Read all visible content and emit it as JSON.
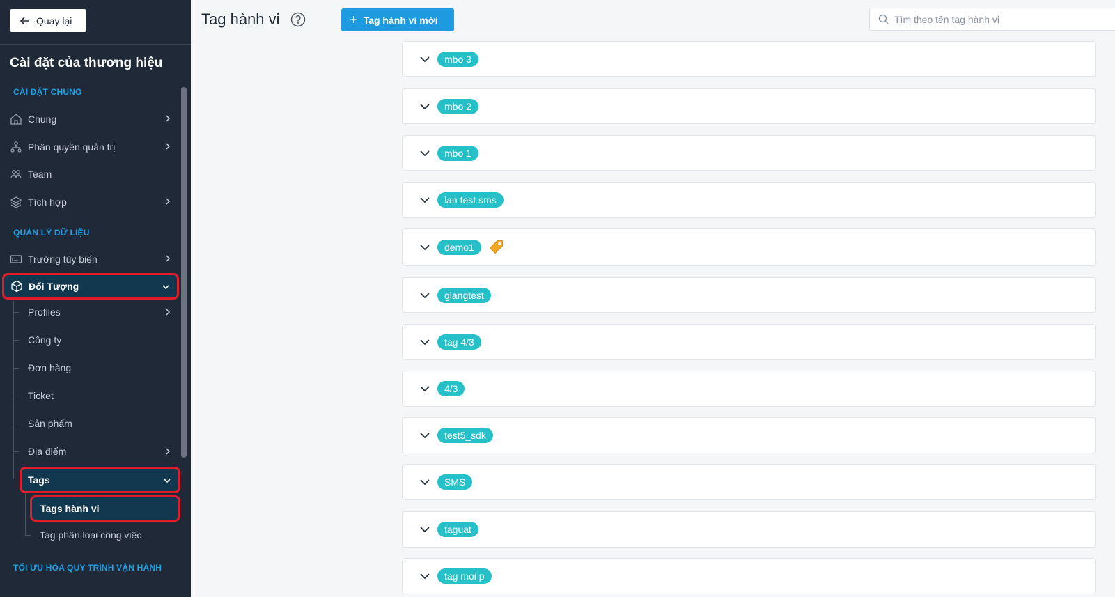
{
  "sidebar": {
    "back_label": "Quay lại",
    "title": "Cài đặt của thương hiệu",
    "section_general": "CÀI ĐẶT CHUNG",
    "section_data": "QUẢN LÝ DỮ LIỆU",
    "section_optimize": "TỐI ƯU HÓA QUY TRÌNH VẬN HÀNH",
    "items": [
      {
        "label": "Chung",
        "icon": "home-icon"
      },
      {
        "label": "Phân quyền quản trị",
        "icon": "hierarchy-icon"
      },
      {
        "label": "Team",
        "icon": "team-icon"
      },
      {
        "label": "Tích hợp",
        "icon": "layers-icon"
      },
      {
        "label": "Trường tùy biến",
        "icon": "field-icon"
      },
      {
        "label": "Đối Tượng",
        "icon": "cube-icon"
      }
    ],
    "sub_items": [
      {
        "label": "Profiles"
      },
      {
        "label": "Công ty"
      },
      {
        "label": "Đơn hàng"
      },
      {
        "label": "Ticket"
      },
      {
        "label": "Sản phẩm"
      },
      {
        "label": "Địa điểm"
      },
      {
        "label": "Tags"
      },
      {
        "label": "Tags hành vi"
      },
      {
        "label": "Tag phân loại công việc"
      }
    ]
  },
  "header": {
    "title": "Tag hành vi",
    "new_button": "Tag hành vi mới",
    "search_placeholder": "Tìm theo tên tag hành vi"
  },
  "tags": [
    {
      "name": "mbo 3"
    },
    {
      "name": "mbo 2"
    },
    {
      "name": "mbo 1"
    },
    {
      "name": "lan test sms"
    },
    {
      "name": "demo1",
      "icon": "tag-icon"
    },
    {
      "name": "giangtest"
    },
    {
      "name": "tag 4/3"
    },
    {
      "name": "4/3"
    },
    {
      "name": "test5_sdk"
    },
    {
      "name": "SMS"
    },
    {
      "name": "taguat"
    },
    {
      "name": "tag moi p"
    }
  ],
  "colors": {
    "sidebar_bg": "#1f2937",
    "accent": "#1e9be0",
    "pill": "#26c0c9",
    "highlight_border": "#e01e2b"
  }
}
